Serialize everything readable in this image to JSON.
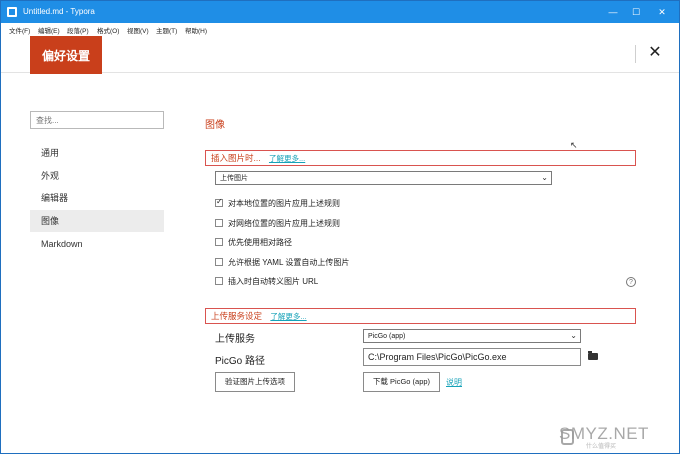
{
  "window": {
    "title": "Untitled.md - Typora",
    "controls": {
      "minimize": "—",
      "maximize": "☐",
      "close": "✕"
    }
  },
  "menu": [
    "文件(F)",
    "编辑(E)",
    "段落(P)",
    "格式(O)",
    "视图(V)",
    "主题(T)",
    "帮助(H)"
  ],
  "header": {
    "tab_label": "偏好设置",
    "close_label": "✕"
  },
  "sidebar": {
    "search_placeholder": "查找...",
    "items": [
      "通用",
      "外观",
      "编辑器",
      "图像",
      "Markdown"
    ],
    "active": "图像"
  },
  "section": {
    "title": "图像"
  },
  "insert": {
    "heading": "插入图片时...",
    "learn_more": "了解更多...",
    "selected": "上传图片",
    "options": [
      {
        "label": "对本地位置的图片应用上述规则",
        "checked": true
      },
      {
        "label": "对网络位置的图片应用上述规则",
        "checked": false
      },
      {
        "label": "优先使用相对路径",
        "checked": false
      },
      {
        "label": "允许根据 YAML 设置自动上传图片",
        "checked": false
      },
      {
        "label": "插入时自动转义图片 URL",
        "checked": false
      }
    ],
    "help_icon": "?"
  },
  "upload": {
    "heading": "上传服务设定",
    "learn_more": "了解更多...",
    "service_label": "上传服务",
    "service_selected": "PicGo (app)",
    "path_label": "PicGo 路径",
    "path_value": "C:\\Program Files\\PicGo\\PicGo.exe",
    "verify_button": "验证图片上传选项",
    "download_button": "下载 PicGo (app)",
    "explain_link": "说明"
  },
  "watermark": {
    "text": "SMYZ.NET",
    "sub": "什么值得买"
  },
  "colors": {
    "accent": "#c93f1b",
    "titlebar": "#1f8ee6",
    "link": "#17a2b8"
  }
}
